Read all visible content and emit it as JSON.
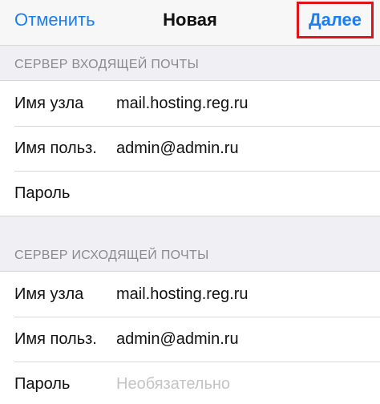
{
  "navbar": {
    "cancel_label": "Отменить",
    "title": "Новая",
    "next_label": "Далее"
  },
  "incoming": {
    "header": "СЕРВЕР ВХОДЯЩЕЙ ПОЧТЫ",
    "rows": [
      {
        "label": "Имя узла",
        "value": "mail.hosting.reg.ru",
        "placeholder": ""
      },
      {
        "label": "Имя польз.",
        "value": "admin@admin.ru",
        "placeholder": ""
      },
      {
        "label": "Пароль",
        "value": "",
        "placeholder": ""
      }
    ]
  },
  "outgoing": {
    "header": "СЕРВЕР ИСХОДЯЩЕЙ ПОЧТЫ",
    "rows": [
      {
        "label": "Имя узла",
        "value": "mail.hosting.reg.ru",
        "placeholder": ""
      },
      {
        "label": "Имя польз.",
        "value": "admin@admin.ru",
        "placeholder": ""
      },
      {
        "label": "Пароль",
        "value": "",
        "placeholder": "Необязательно"
      }
    ]
  },
  "colors": {
    "accent": "#1a7ef7",
    "highlight_border": "#e0131b",
    "background": "#efeff4",
    "header_text": "#8a8a8f",
    "placeholder_text": "#c4c4c8"
  }
}
